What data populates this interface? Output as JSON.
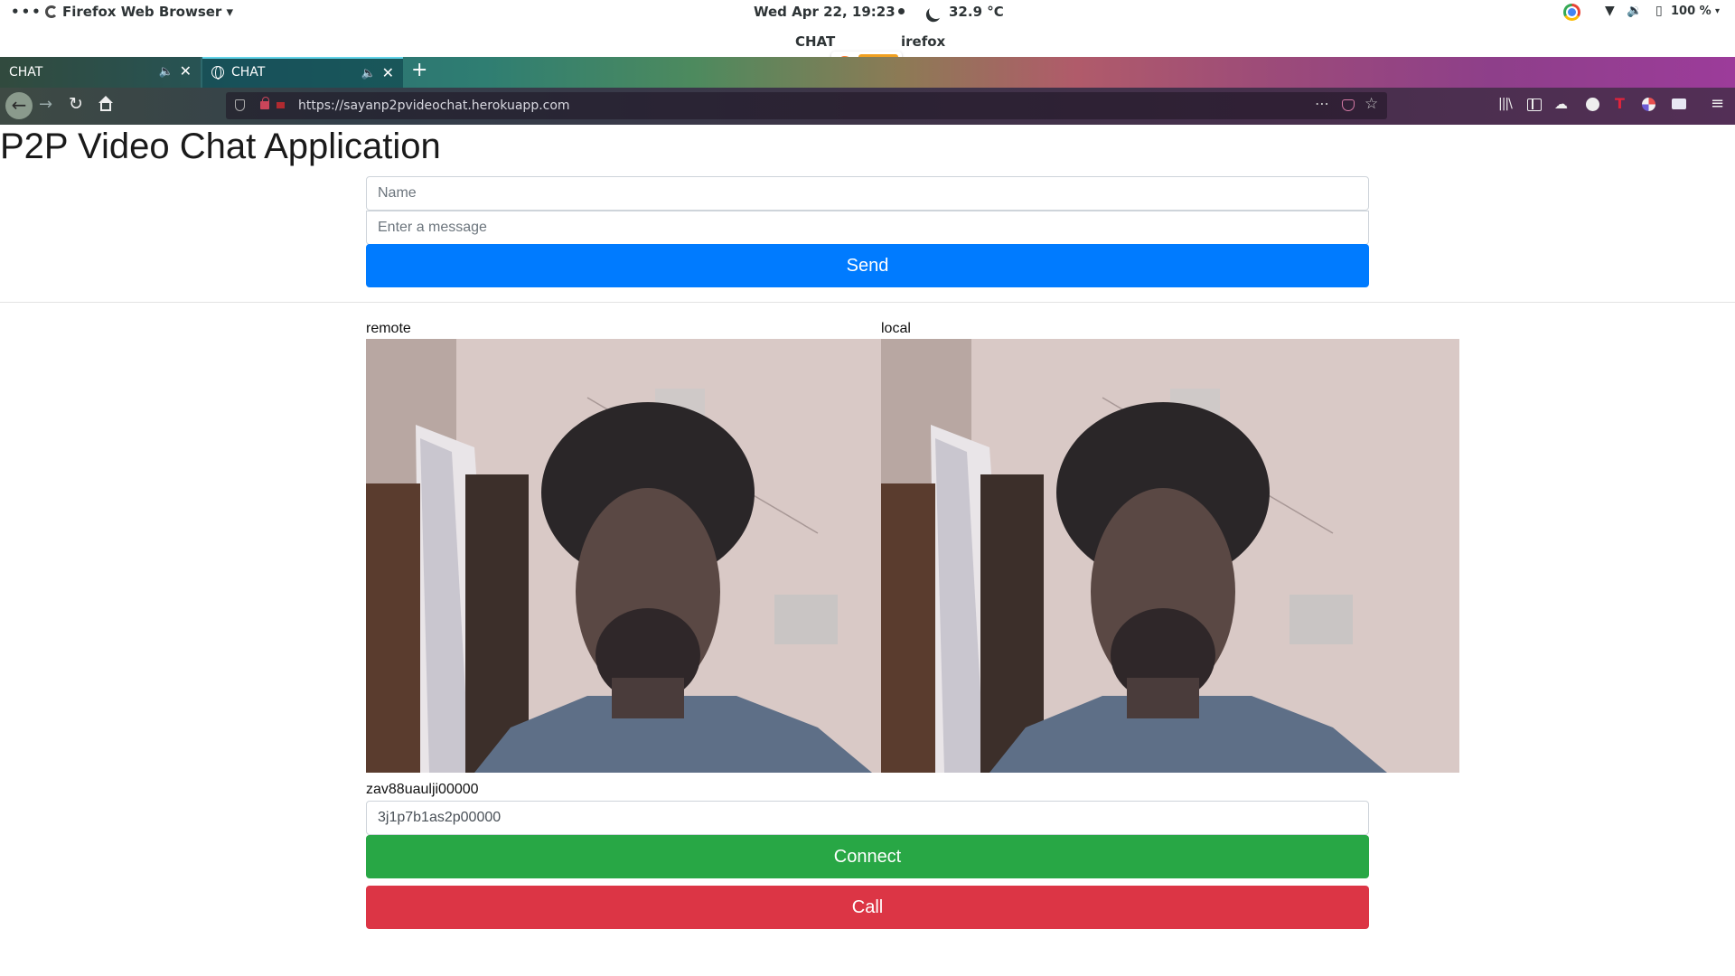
{
  "topbar": {
    "activities": "•••",
    "app_menu": "Firefox Web Browser ▾",
    "clock": "Wed Apr 22, 19:23",
    "weather": "32.9 °C",
    "battery": "100 %",
    "tray_caret": "▾",
    "wifi_icon": "▼",
    "volume_icon": "🔉",
    "battery_icon": "▯"
  },
  "window": {
    "title_left": "CHAT",
    "title_right": "irefox"
  },
  "tabs": [
    {
      "label": "CHAT",
      "audio_icon": "🔈",
      "close": "✕"
    },
    {
      "label": "CHAT",
      "audio_icon": "🔈",
      "close": "✕"
    }
  ],
  "new_tab": "+",
  "nav": {
    "back": "←",
    "forward": "→",
    "reload": "↻",
    "url": "https://sayanp2pvideochat.herokuapp.com",
    "more": "⋯",
    "star": "☆",
    "library": "|||\\",
    "sync": "☁",
    "ext_t": "T",
    "menu": "≡"
  },
  "page": {
    "title": "P2P Video Chat Application",
    "name_placeholder": "Name",
    "message_placeholder": "Enter a message",
    "send_label": "Send",
    "remote_label": "remote",
    "local_label": "local",
    "peer_id": "zav88uaulji00000",
    "remote_id_value": "3j1p7b1as2p00000",
    "connect_label": "Connect",
    "call_label": "Call"
  },
  "colors": {
    "send": "#007bff",
    "connect": "#28a745",
    "call": "#dc3545"
  }
}
